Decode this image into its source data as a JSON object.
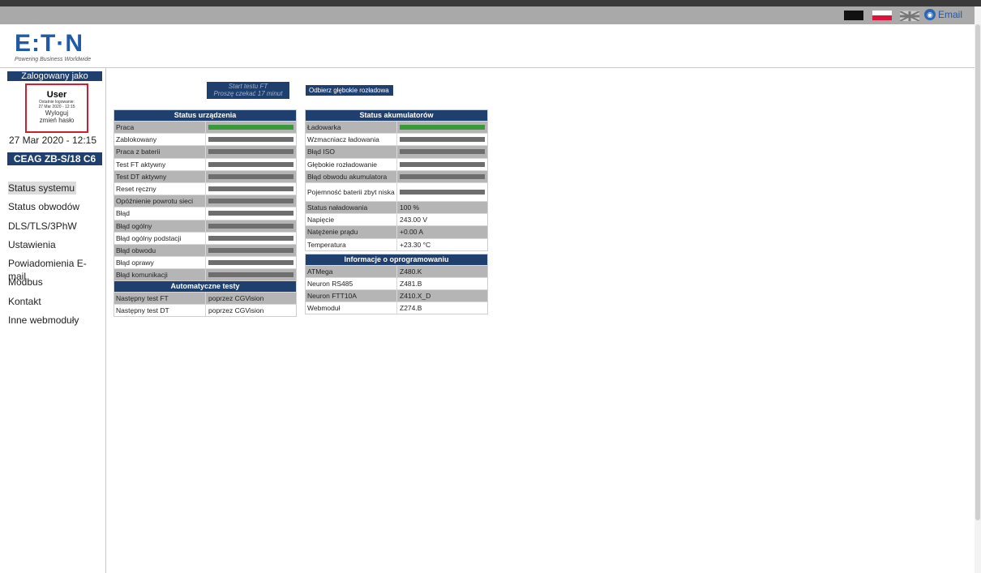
{
  "topbar": {
    "email_label": "Email"
  },
  "header": {
    "logo_text": "E:T·N",
    "tagline": "Powering Business Worldwide"
  },
  "sidebar": {
    "logged_in_as": "Zalogowany jako",
    "user": "User",
    "last_login_label": "Ostatnie logowanie:",
    "last_login_value": "27 Mar 2020 - 12:15",
    "logout": "Wyloguj",
    "change_password": "zmień hasło",
    "datetime": "27 Mar 2020 - 12:15",
    "device": "CEAG ZB-S/18 C6",
    "nav": [
      {
        "label": "Status systemu"
      },
      {
        "label": "Status obwodów"
      },
      {
        "label": "DLS/TLS/3PhW"
      },
      {
        "label": "Ustawienia"
      },
      {
        "label": "Powiadomienia E-mail"
      },
      {
        "label": "Modbus"
      },
      {
        "label": "Kontakt"
      },
      {
        "label": "Inne webmoduły"
      }
    ]
  },
  "actions": {
    "ft_line1": "Start testu FT",
    "ft_line2": "Proszę czekać 17 minut",
    "ack_deep_discharge": "Odbierz głębokie rozładowa"
  },
  "device_status": {
    "title": "Status urządzenia",
    "rows": [
      {
        "label": "Praca",
        "state": "on"
      },
      {
        "label": "Zablokowany",
        "state": "off"
      },
      {
        "label": "Praca z baterii",
        "state": "off"
      },
      {
        "label": "Test FT aktywny",
        "state": "off"
      },
      {
        "label": "Test DT aktywny",
        "state": "off"
      },
      {
        "label": "Reset ręczny",
        "state": "off"
      },
      {
        "label": "Opóźnienie powrotu sieci",
        "state": "off"
      },
      {
        "label": "Błąd",
        "state": "off"
      },
      {
        "label": "Błąd ogólny",
        "state": "off"
      },
      {
        "label": "Błąd ogólny podstacji",
        "state": "off"
      },
      {
        "label": "Błąd obwodu",
        "state": "off"
      },
      {
        "label": "Błąd oprawy",
        "state": "off"
      },
      {
        "label": "Błąd komunikacji",
        "state": "off"
      }
    ]
  },
  "auto_tests": {
    "title": "Automatyczne testy",
    "rows": [
      {
        "label": "Następny test FT",
        "value": "poprzez CGVision"
      },
      {
        "label": "Następny test DT",
        "value": "poprzez CGVision"
      }
    ]
  },
  "battery_status": {
    "title": "Status akumulatorów",
    "bar_rows": [
      {
        "label": "Ładowarka",
        "state": "on"
      },
      {
        "label": "Wzmacniacz ładowania",
        "state": "off"
      },
      {
        "label": "Błąd ISO",
        "state": "off"
      },
      {
        "label": "Głębokie rozładowanie",
        "state": "off"
      },
      {
        "label": "Błąd obwodu akumulatora",
        "state": "off"
      },
      {
        "label": "Pojemność baterii zbyt niska",
        "state": "off"
      }
    ],
    "value_rows": [
      {
        "label": "Status naładowania",
        "value": "100 %"
      },
      {
        "label": "Napięcie",
        "value": "243.00 V"
      },
      {
        "label": "Natężenie prądu",
        "value": "+0.00 A"
      },
      {
        "label": "Temperatura",
        "value": "+23.30 °C"
      }
    ]
  },
  "software_info": {
    "title": "Informacje o oprogramowaniu",
    "rows": [
      {
        "label": "ATMega",
        "value": "Z480.K"
      },
      {
        "label": "Neuron RS485",
        "value": "Z481.B"
      },
      {
        "label": "Neuron FTT10A",
        "value": "Z410.X_D"
      },
      {
        "label": "Webmoduł",
        "value": "Z274.B"
      }
    ]
  },
  "colors": {
    "navy": "#1f3f6e",
    "active_green": "#3a9a3a",
    "inactive_gray": "#6e6e6e",
    "login_box_red": "#cc1f2f"
  }
}
